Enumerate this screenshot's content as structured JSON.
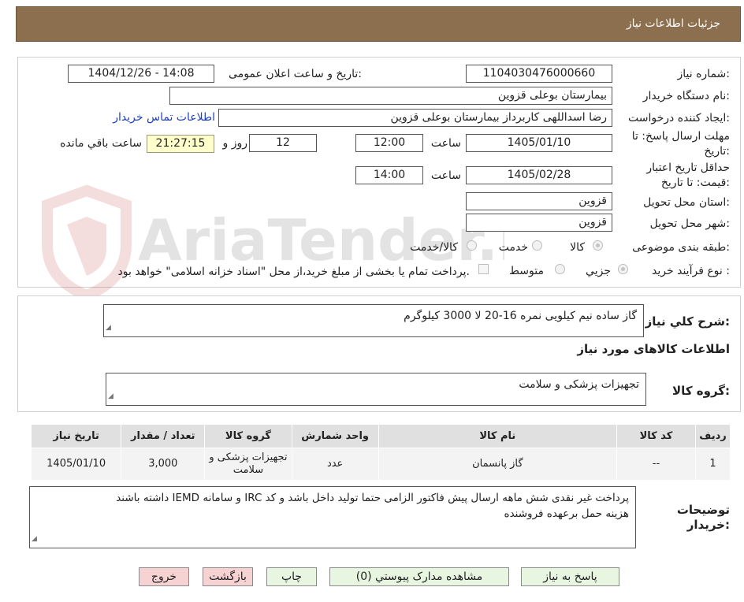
{
  "header": {
    "title": "جزئیات اطلاعات نیاز"
  },
  "watermark": {
    "text": "AriaTender.neT"
  },
  "form": {
    "need_number_label": "شماره نیاز:",
    "need_number": "1104030476000660",
    "announce_label": "تاریخ و ساعت اعلان عمومی:",
    "announce_value": "1404/12/26 - 14:08",
    "buyer_org_label": "نام دستگاه خریدار:",
    "buyer_org": "بیمارستان بوعلی قزوین",
    "requester_label": "ایجاد کننده درخواست:",
    "requester": "رضا اسداللهی کاربرداز بیمارستان بوعلی قزوین",
    "contact_link": "اطلاعات تماس خریدار",
    "deadline_label_1": "مهلت ارسال پاسخ: تا",
    "deadline_label_2": "تاریخ:",
    "deadline_date": "1405/01/10",
    "time_word": "ساعت",
    "deadline_time": "12:00",
    "days_value": "12",
    "days_word": "روز و",
    "remaining_time": "21:27:15",
    "remaining_word": "ساعت باقي مانده",
    "validity_label_1": "حداقل تاریخ اعتبار",
    "validity_label_2": "قیمت: تا تاریخ:",
    "validity_date": "1405/02/28",
    "validity_time": "14:00",
    "province_label": "استان محل تحویل:",
    "province": "قزوین",
    "city_label": "شهر محل تحویل:",
    "city": "قزوین",
    "category_label": "طبقه بندی موضوعی:",
    "category_options": [
      "کالا",
      "خدمت",
      "کالا/خدمت"
    ],
    "process_label": "نوع فرآیند خرید :",
    "process_options": [
      "جزیي",
      "متوسط"
    ],
    "payment_note": "پرداخت تمام یا بخشی از مبلغ خرید،از محل \"اسناد خزانه اسلامی\" خواهد بود."
  },
  "summary": {
    "label": "شرح کلي نیاز:",
    "text": "گاز ساده نیم کیلویی نمره 16-20 لا    3000 کیلوگرم",
    "goods_info_title": "اطلاعات کالاهای مورد نیاز",
    "group_label": "گروه کالا:",
    "group_value": "تجهیزات پزشکی و سلامت"
  },
  "table": {
    "headers": [
      "ردیف",
      "کد کالا",
      "نام کالا",
      "واحد شمارش",
      "گروه کالا",
      "تعداد / مقدار",
      "تاریخ نیاز"
    ],
    "rows": [
      [
        "1",
        "--",
        "گاز پانسمان",
        "عدد",
        "تجهیزات پزشکی و سلامت",
        "3,000",
        "1405/01/10"
      ]
    ]
  },
  "notes": {
    "label_1": "توضیحات",
    "label_2": "خریدار:",
    "line1": "پرداخت غیر نقدی شش ماهه ارسال پیش فاکتور الزامی حتما تولید داخل باشد و کد IRC و سامانه IEMD داشته باشند",
    "line2": "هزینه حمل برعهده فروشنده"
  },
  "buttons": {
    "reply": "پاسخ به نیاز",
    "attachments": "مشاهده مدارک پیوستي (0)",
    "print": "چاپ",
    "back": "بازگشت",
    "exit": "خروج"
  }
}
